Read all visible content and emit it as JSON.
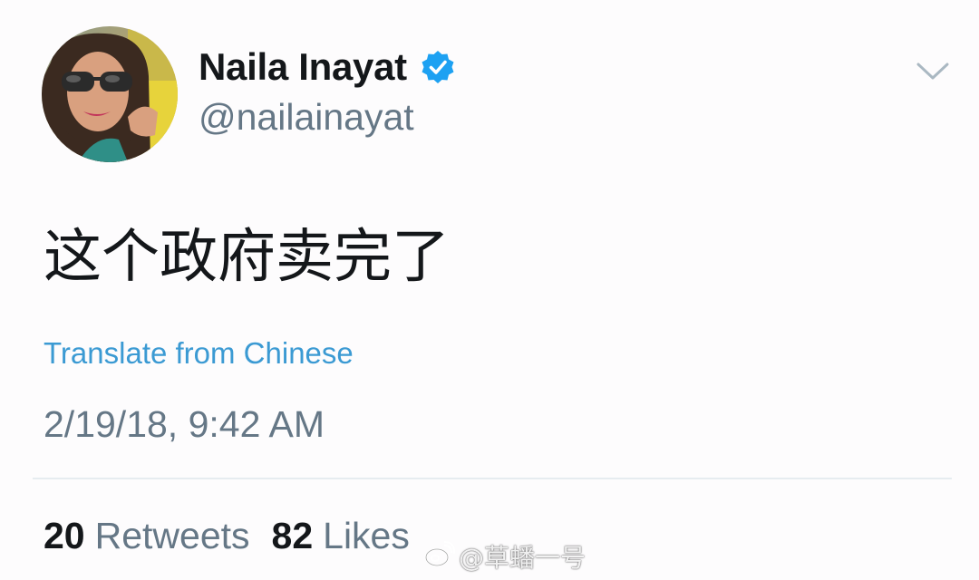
{
  "author": {
    "display_name": "Naila Inayat",
    "handle": "@nailainayat",
    "verified": true
  },
  "tweet": {
    "text": "这个政府卖完了",
    "translate_label": "Translate from Chinese",
    "timestamp": "2/19/18, 9:42 AM"
  },
  "stats": {
    "retweets_count": "20",
    "retweets_label": "Retweets",
    "likes_count": "82",
    "likes_label": "Likes"
  },
  "watermark": {
    "text": "@草蟠一号"
  },
  "icons": {
    "verified": "verified-badge-icon",
    "menu": "chevron-down-icon",
    "watermark_logo": "weibo-logo-icon"
  },
  "colors": {
    "link": "#3b9ad3",
    "verified": "#1da1f2",
    "secondary_text": "#657786",
    "primary_text": "#14171a"
  }
}
